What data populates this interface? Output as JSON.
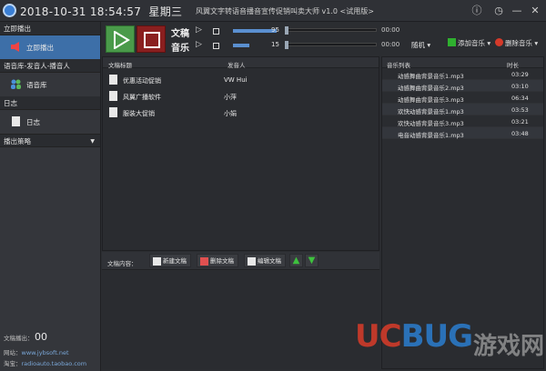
{
  "titlebar": {
    "datetime": "2018-10-31 18:54:57",
    "weekday": "星期三",
    "app_title": "风翼文字转语音播音宣传促销叫卖大师 v1.0 <试用版>"
  },
  "sidebar": {
    "section_broadcast": "立即播出",
    "item_broadcast": "立即播出",
    "section_voice": "语音库-发音人-播音人",
    "item_voice": "语音库",
    "section_log": "日志",
    "item_log": "日志",
    "strategy": "播出策略",
    "count_label": "文稿播出：",
    "count_value": "00",
    "website_label": "网站：",
    "website": "www.jybsoft.net",
    "taobao_label": "淘宝：",
    "taobao": "radioauto.taobao.com"
  },
  "controls": {
    "doc_label": "文稿",
    "doc_volume": "95",
    "doc_volume_pct": 95,
    "doc_time": "00:00",
    "music_label": "音乐",
    "music_volume": "15",
    "music_volume_pct": 15,
    "music_time": "00:00",
    "mode": "随机",
    "add_music": "添加音乐",
    "del_music": "删除音乐"
  },
  "documents": {
    "col_title": "文稿标题",
    "col_author": "发音人",
    "rows": [
      {
        "title": "优惠活动促销",
        "author": "VW Hui"
      },
      {
        "title": "风翼广播软件",
        "author": "小萍"
      },
      {
        "title": "服装大促销",
        "author": "小娟"
      }
    ]
  },
  "content": {
    "label": "文稿内容：",
    "new_doc": "新建文稿",
    "delete_doc": "删除文稿",
    "edit_doc": "编辑文稿"
  },
  "music": {
    "col_name": "音乐列表",
    "col_duration": "时长",
    "rows": [
      {
        "name": "动感舞曲背景音乐1.mp3",
        "duration": "03:29"
      },
      {
        "name": "动感舞曲背景音乐2.mp3",
        "duration": "03:10"
      },
      {
        "name": "动感舞曲背景音乐3.mp3",
        "duration": "06:34"
      },
      {
        "name": "欢快动感背景音乐1.mp3",
        "duration": "03:53"
      },
      {
        "name": "欢快动感背景音乐3.mp3",
        "duration": "03:21"
      },
      {
        "name": "电音动感背景音乐1.mp3",
        "duration": "03:48"
      }
    ]
  },
  "watermark": {
    "uc": "UC",
    "bug": "BUG",
    "tail": "游戏网"
  },
  "colors": {
    "accent": "#3d6fa8",
    "play": "#4a9a4a",
    "stop": "#8a1f1f",
    "volume": "#5a8fd0"
  }
}
